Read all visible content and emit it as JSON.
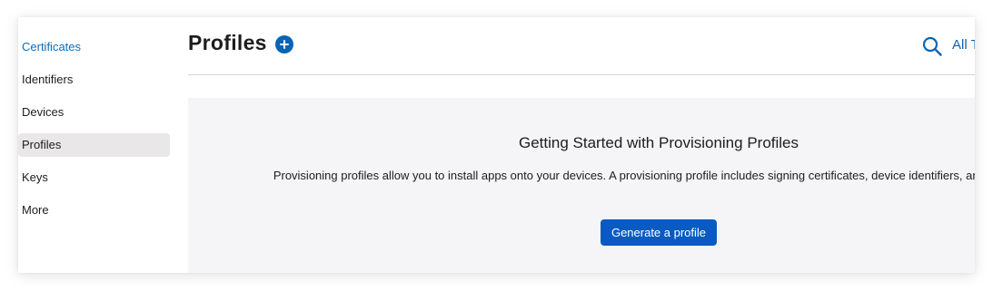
{
  "sidebar": {
    "items": [
      {
        "label": "Certificates"
      },
      {
        "label": "Identifiers"
      },
      {
        "label": "Devices"
      },
      {
        "label": "Profiles"
      },
      {
        "label": "Keys"
      },
      {
        "label": "More"
      }
    ],
    "selected": "Profiles"
  },
  "header": {
    "title": "Profiles",
    "add_icon": "plus-circle-icon",
    "search_icon": "search-icon",
    "filter_label": "All Types"
  },
  "empty_state": {
    "heading": "Getting Started with Provisioning Profiles",
    "description": "Provisioning profiles allow you to install apps onto your devices. A provisioning profile includes signing certificates, device identifiers, and an App ID.",
    "button_label": "Generate a profile"
  },
  "colors": {
    "accent": "#0a64b4",
    "link": "#0a6ebd",
    "selected_bg": "#e9e7e8",
    "panel_bg": "#f5f5f7",
    "button_bg": "#0a5bc1"
  }
}
